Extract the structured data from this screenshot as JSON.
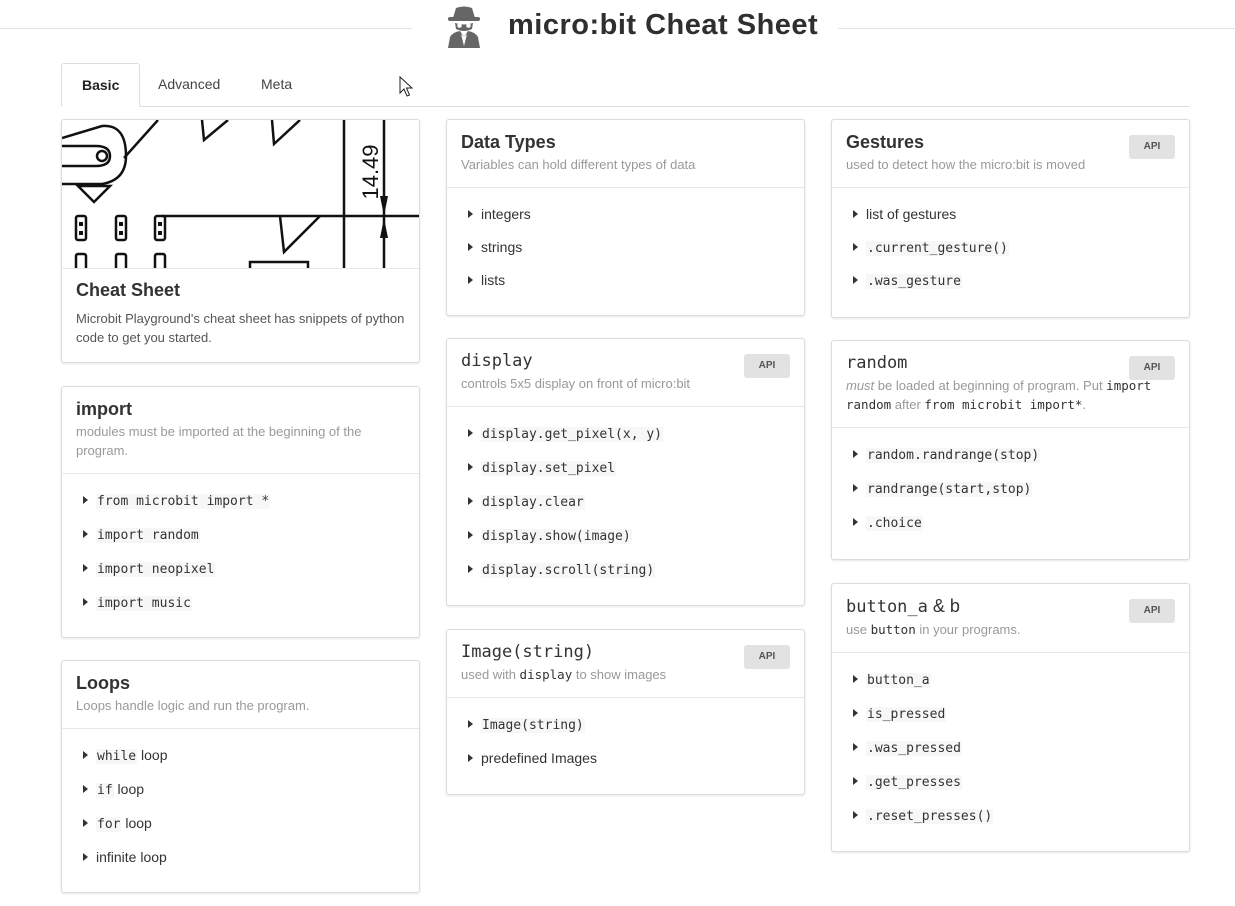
{
  "page": {
    "title": "micro:bit Cheat Sheet",
    "logo_icon": "spy-icon"
  },
  "tabs": [
    {
      "label": "Basic"
    },
    {
      "label": "Advanced"
    },
    {
      "label": "Meta"
    }
  ],
  "cards": {
    "cheat_sheet": {
      "title": "Cheat Sheet",
      "description": "Microbit Playground's cheat sheet has snippets of python code to get you started.",
      "drawing_label": "14.49"
    },
    "import": {
      "title": "import",
      "subtitle": "modules must be imported at the beginning of the program.",
      "items": [
        "from microbit import *",
        "import random",
        "import neopixel",
        "import music"
      ]
    },
    "loops": {
      "title": "Loops",
      "subtitle": "Loops handle logic and run the program.",
      "items": [
        {
          "code": "while",
          "text": " loop"
        },
        {
          "code": "if",
          "text": " loop"
        },
        {
          "code": "for",
          "text": " loop"
        },
        {
          "code": "",
          "text": "infinite loop"
        }
      ]
    },
    "data_types": {
      "title": "Data Types",
      "subtitle": "Variables can hold different types of data",
      "items": [
        "integers",
        "strings",
        "lists"
      ]
    },
    "display": {
      "title": "display",
      "subtitle": "controls 5x5 display on front of micro:bit",
      "badge": "API",
      "items": [
        "display.get_pixel(x, y)",
        "display.set_pixel",
        "display.clear",
        "display.show(image)",
        "display.scroll(string)"
      ]
    },
    "image": {
      "title": "Image(string)",
      "subtitle_pre": "used with ",
      "subtitle_code": "display",
      "subtitle_post": " to show images",
      "badge": "API",
      "items": [
        {
          "code": "Image(string)"
        },
        {
          "text": "predefined Images"
        }
      ]
    },
    "gestures": {
      "title": "Gestures",
      "subtitle": "used to detect how the micro:bit is moved",
      "badge": "API",
      "items": [
        {
          "text": "list of gestures"
        },
        {
          "code": ".current_gesture()"
        },
        {
          "code": ".was_gesture"
        }
      ]
    },
    "random": {
      "title": "random",
      "subtitle_em": "must",
      "subtitle_1": " be loaded at beginning of program. Put ",
      "subtitle_code1": "import random",
      "subtitle_2": " after ",
      "subtitle_code2": "from microbit import*",
      "subtitle_3": ".",
      "badge": "API",
      "items": [
        "random.randrange(stop)",
        "randrange(start,stop)",
        ".choice"
      ]
    },
    "button": {
      "title_code": "button_a",
      "title_text": " & b",
      "subtitle_pre": "use ",
      "subtitle_code": "button",
      "subtitle_post": " in your programs.",
      "badge": "API",
      "items": [
        "button_a",
        "is_pressed",
        ".was_pressed",
        ".get_presses",
        ".reset_presses()"
      ]
    }
  }
}
